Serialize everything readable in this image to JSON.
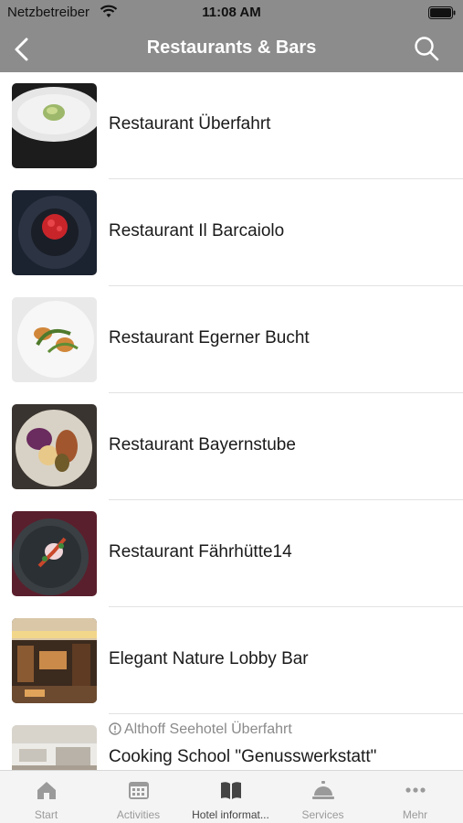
{
  "status_bar": {
    "carrier": "Netzbetreiber",
    "time": "11:08 AM"
  },
  "nav": {
    "title": "Restaurants & Bars",
    "back_icon": "chevron-left-icon",
    "search_icon": "search-icon"
  },
  "list": [
    {
      "label": "Restaurant Überfahrt"
    },
    {
      "label": "Restaurant Il Barcaiolo"
    },
    {
      "label": "Restaurant Egerner Bucht"
    },
    {
      "label": "Restaurant Bayernstube"
    },
    {
      "label": "Restaurant Fährhütte14"
    },
    {
      "label": "Elegant Nature Lobby Bar"
    },
    {
      "meta": "Althoff Seehotel Überfahrt",
      "label": "Cooking School \"Genusswerkstatt\""
    }
  ],
  "tabs": [
    {
      "label": "Start",
      "icon": "home-icon"
    },
    {
      "label": "Activities",
      "icon": "calendar-icon"
    },
    {
      "label": "Hotel informat...",
      "icon": "book-icon"
    },
    {
      "label": "Services",
      "icon": "service-bell-icon"
    },
    {
      "label": "Mehr",
      "icon": "more-dots-icon"
    }
  ],
  "colors": {
    "nav_bg": "#8c8c8c",
    "active_tab": "#444444",
    "inactive_tab": "#9a9a9a"
  }
}
